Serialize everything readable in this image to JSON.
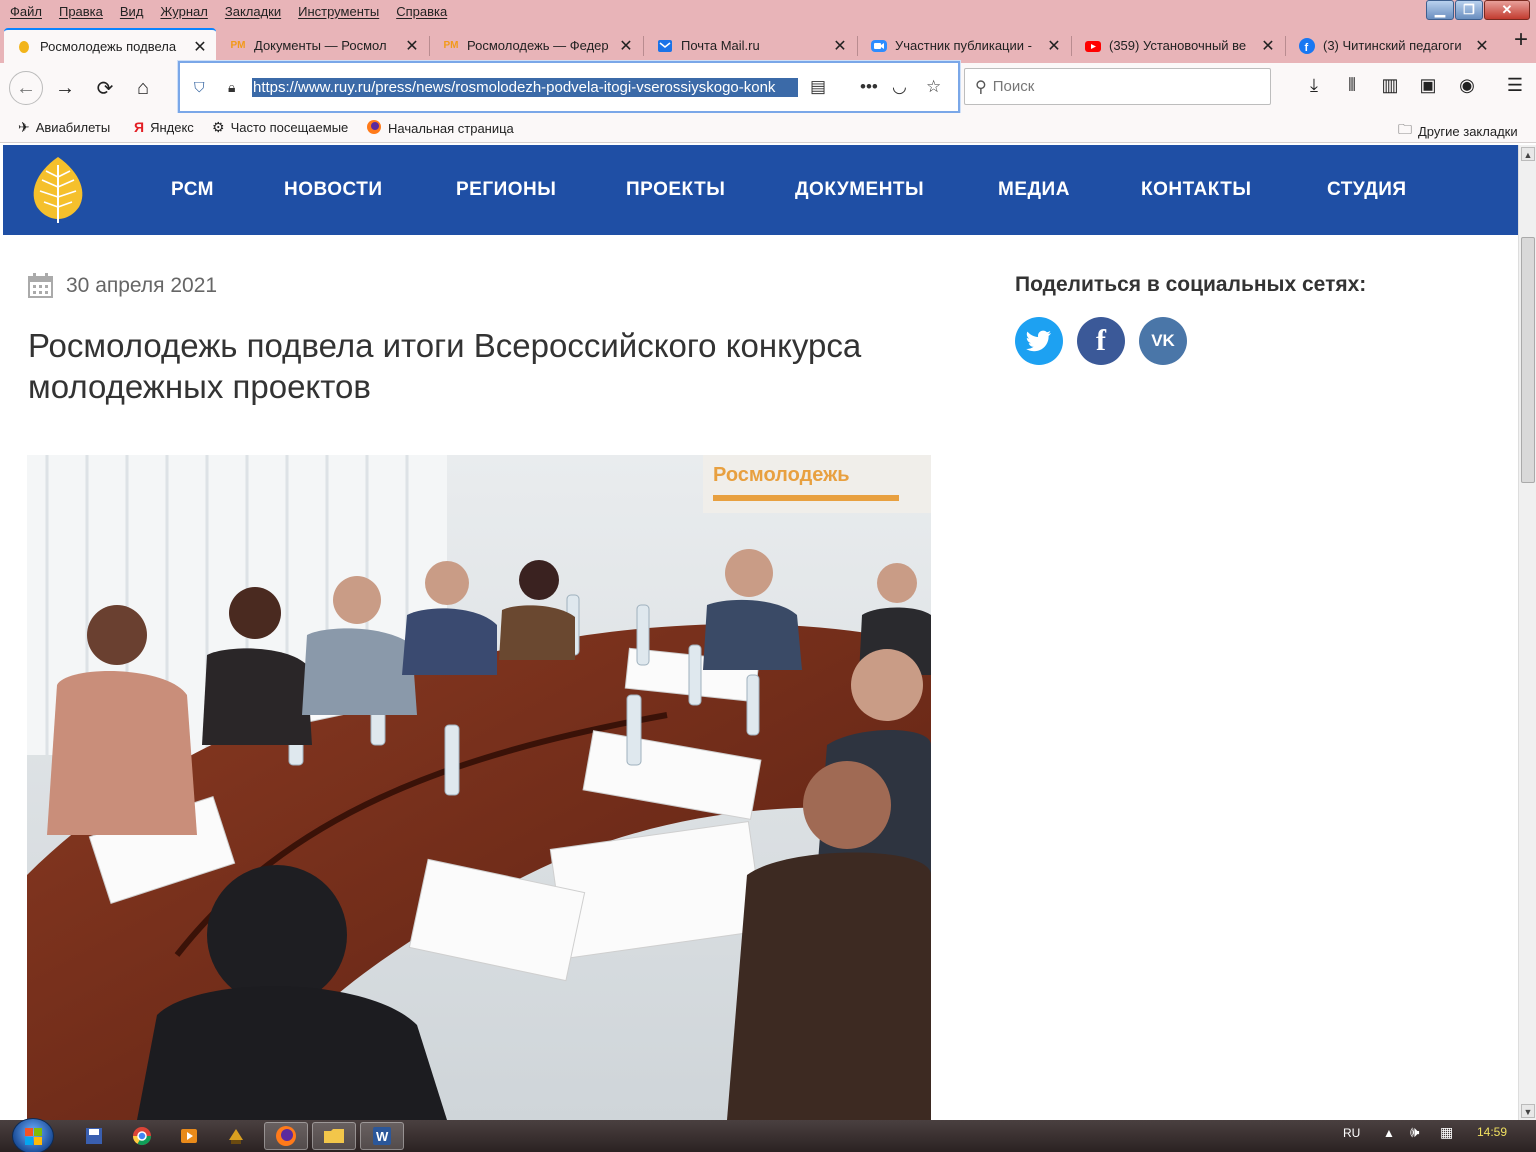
{
  "menubar": {
    "items": [
      "Файл",
      "Правка",
      "Вид",
      "Журнал",
      "Закладки",
      "Инструменты",
      "Справка"
    ]
  },
  "tabs": [
    {
      "label": "Росмолодежь подвела",
      "icon": "aspen-favicon"
    },
    {
      "label": "Документы — Росмол",
      "icon": "rm-favicon"
    },
    {
      "label": "Росмолодежь — Федер",
      "icon": "rm-favicon"
    },
    {
      "label": "Почта Mail.ru",
      "icon": "mail-icon"
    },
    {
      "label": "Участник публикации -",
      "icon": "zoom-icon"
    },
    {
      "label": "(359) Установочный ве",
      "icon": "youtube-icon"
    },
    {
      "label": "(3) Читинский педагоги",
      "icon": "facebook-icon"
    }
  ],
  "toolbar": {
    "url": "https://www.ruy.ru/press/news/rosmolodezh-podvela-itogi-vserossiyskogo-konk",
    "search_placeholder": "Поиск"
  },
  "bookmarks": {
    "items": [
      "Авиабилеты",
      "Яндекс",
      "Часто посещаемые",
      "Начальная страница"
    ],
    "other": "Другие закладки"
  },
  "site": {
    "nav": [
      "РСМ",
      "НОВОСТИ",
      "РЕГИОНЫ",
      "ПРОЕКТЫ",
      "ДОКУМЕНТЫ",
      "МЕДИА",
      "КОНТАКТЫ",
      "СТУДИЯ"
    ],
    "accent": "#1f4fa5"
  },
  "article": {
    "date": "30 апреля 2021",
    "title": "Росмолодежь подвела итоги Всероссийского конкурса молодежных проектов",
    "photo_banner": "Росмолодежь"
  },
  "share": {
    "title": "Поделиться в социальных сетях:"
  },
  "taskbar": {
    "lang": "RU",
    "time": "14:59"
  }
}
